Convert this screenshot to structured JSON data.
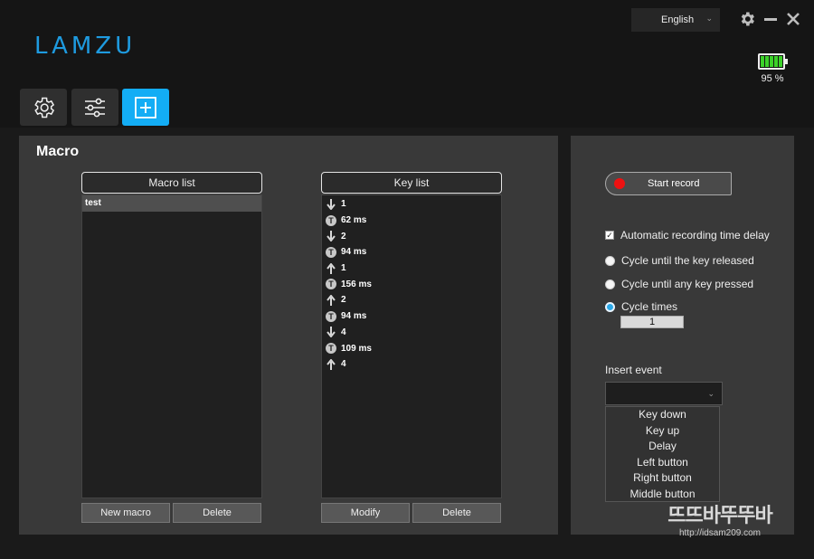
{
  "app": {
    "logo": "LAMZU",
    "language": "English",
    "battery_percent_label": "95 %",
    "battery_level": 0.95,
    "accent_color": "#13adf5"
  },
  "tabs": [
    {
      "name": "settings",
      "icon": "gear-icon",
      "active": false
    },
    {
      "name": "adjust",
      "icon": "sliders-icon",
      "active": false
    },
    {
      "name": "macro",
      "icon": "plus-square-icon",
      "active": true
    }
  ],
  "macro": {
    "title": "Macro",
    "macro_list_header": "Macro list",
    "macro_items": [
      "test"
    ],
    "key_list_header": "Key list",
    "key_events": [
      {
        "type": "down",
        "text": "1"
      },
      {
        "type": "delay",
        "text": "62 ms"
      },
      {
        "type": "down",
        "text": "2"
      },
      {
        "type": "delay",
        "text": "94 ms"
      },
      {
        "type": "up",
        "text": "1"
      },
      {
        "type": "delay",
        "text": "156 ms"
      },
      {
        "type": "up",
        "text": "2"
      },
      {
        "type": "delay",
        "text": "94 ms"
      },
      {
        "type": "down",
        "text": "4"
      },
      {
        "type": "delay",
        "text": "109 ms"
      },
      {
        "type": "up",
        "text": "4"
      }
    ],
    "new_macro_label": "New macro",
    "delete_label": "Delete",
    "modify_label": "Modify",
    "key_delete_label": "Delete"
  },
  "record": {
    "start_label": "Start record",
    "auto_delay_label": "Automatic recording time delay",
    "auto_delay_checked": true,
    "options": [
      {
        "label": "Cycle until the key released",
        "selected": false
      },
      {
        "label": "Cycle until any key pressed",
        "selected": false
      },
      {
        "label": "Cycle times",
        "selected": true
      }
    ],
    "cycle_times_value": "1",
    "insert_event_label": "Insert event",
    "insert_options": [
      "Key down",
      "Key up",
      "Delay",
      "Left button",
      "Right button",
      "Middle button"
    ]
  },
  "watermark": {
    "big": "뜨뜨바뚜뚜바",
    "small": "http://idsam209.com"
  }
}
